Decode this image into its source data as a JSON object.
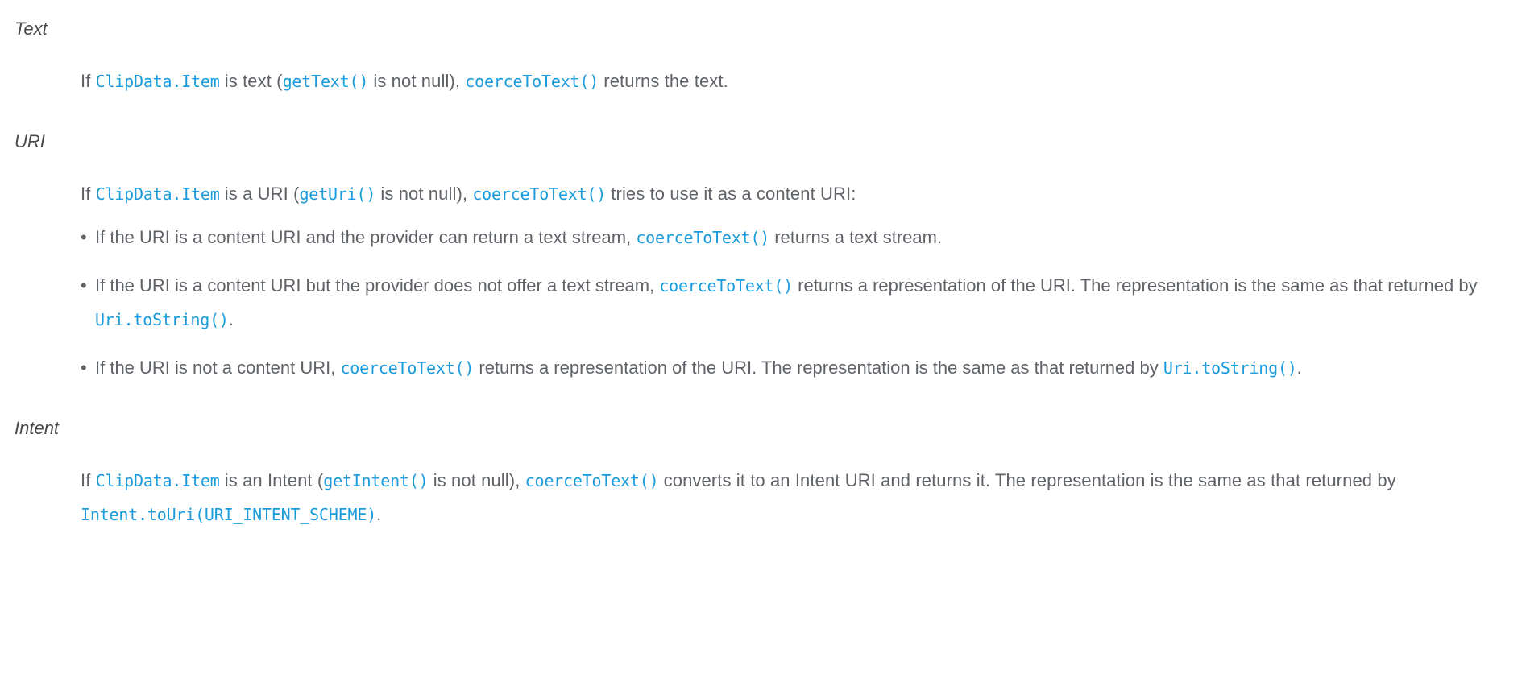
{
  "theme": {
    "background": "#ffffff",
    "text_color": "#5f6368",
    "term_color": "#4a4a4a",
    "code_link_color": "#1a9bdb",
    "bullet_glyph": "•"
  },
  "sections": [
    {
      "term": "Text",
      "paragraph": {
        "parts": [
          {
            "type": "text",
            "value": "If "
          },
          {
            "type": "code",
            "value": "ClipData.Item"
          },
          {
            "type": "text",
            "value": " is text ("
          },
          {
            "type": "code",
            "value": "getText()"
          },
          {
            "type": "text",
            "value": " is not null), "
          },
          {
            "type": "code",
            "value": "coerceToText()"
          },
          {
            "type": "text",
            "value": " returns the text."
          }
        ]
      },
      "bullets": []
    },
    {
      "term": "URI",
      "paragraph": {
        "parts": [
          {
            "type": "text",
            "value": "If "
          },
          {
            "type": "code",
            "value": "ClipData.Item"
          },
          {
            "type": "text",
            "value": " is a URI ("
          },
          {
            "type": "code",
            "value": "getUri()"
          },
          {
            "type": "text",
            "value": " is not null), "
          },
          {
            "type": "code",
            "value": "coerceToText()"
          },
          {
            "type": "text",
            "value": " tries to use it as a content URI:"
          }
        ]
      },
      "bullets": [
        {
          "parts": [
            {
              "type": "text",
              "value": "If the URI is a content URI and the provider can return a text stream, "
            },
            {
              "type": "code",
              "value": "coerceToText()"
            },
            {
              "type": "text",
              "value": " returns a text stream."
            }
          ]
        },
        {
          "parts": [
            {
              "type": "text",
              "value": "If the URI is a content URI but the provider does not offer a text stream, "
            },
            {
              "type": "code",
              "value": "coerceToText()"
            },
            {
              "type": "text",
              "value": " returns a representation of the URI. The representation is the same as that returned by "
            },
            {
              "type": "code",
              "value": "Uri.toString()"
            },
            {
              "type": "text",
              "value": "."
            }
          ]
        },
        {
          "parts": [
            {
              "type": "text",
              "value": "If the URI is not a content URI, "
            },
            {
              "type": "code",
              "value": "coerceToText()"
            },
            {
              "type": "text",
              "value": " returns a representation of the URI. The representation is the same as that returned by "
            },
            {
              "type": "code",
              "value": "Uri.toString()"
            },
            {
              "type": "text",
              "value": "."
            }
          ]
        }
      ]
    },
    {
      "term": "Intent",
      "paragraph": {
        "parts": [
          {
            "type": "text",
            "value": "If "
          },
          {
            "type": "code",
            "value": "ClipData.Item"
          },
          {
            "type": "text",
            "value": " is an Intent ("
          },
          {
            "type": "code",
            "value": "getIntent()"
          },
          {
            "type": "text",
            "value": " is not null), "
          },
          {
            "type": "code",
            "value": "coerceToText()"
          },
          {
            "type": "text",
            "value": " converts it to an Intent URI and returns it. The representation is the same as that returned by "
          },
          {
            "type": "code",
            "value": "Intent.toUri(URI_INTENT_SCHEME)"
          },
          {
            "type": "text",
            "value": "."
          }
        ]
      },
      "bullets": []
    }
  ]
}
